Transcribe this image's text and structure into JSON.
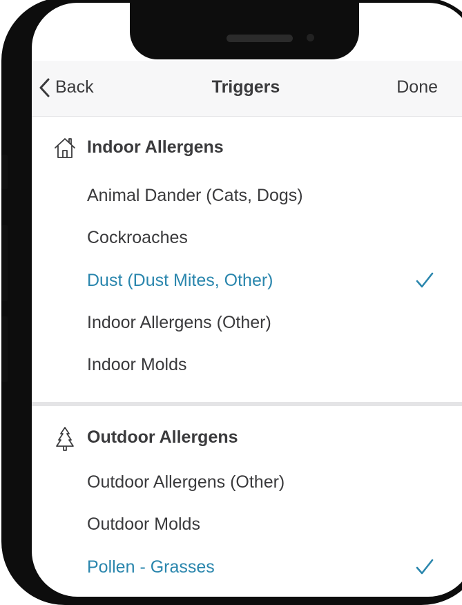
{
  "nav": {
    "back_label": "Back",
    "title": "Triggers",
    "done_label": "Done"
  },
  "sections": [
    {
      "title": "Indoor Allergens",
      "icon": "house-icon",
      "items": [
        {
          "label": "Animal Dander (Cats, Dogs)",
          "selected": false
        },
        {
          "label": "Cockroaches",
          "selected": false
        },
        {
          "label": "Dust (Dust Mites, Other)",
          "selected": true
        },
        {
          "label": "Indoor Allergens (Other)",
          "selected": false
        },
        {
          "label": "Indoor Molds",
          "selected": false
        }
      ]
    },
    {
      "title": "Outdoor Allergens",
      "icon": "tree-icon",
      "items": [
        {
          "label": "Outdoor Allergens (Other)",
          "selected": false
        },
        {
          "label": "Outdoor Molds",
          "selected": false
        },
        {
          "label": "Pollen - Grasses",
          "selected": true
        }
      ]
    }
  ],
  "colors": {
    "accent": "#2a86ad",
    "text": "#3a3a3c",
    "nav_background": "#f7f7f8",
    "divider": "#e4e4e6",
    "frame": "#0d0d0d"
  }
}
